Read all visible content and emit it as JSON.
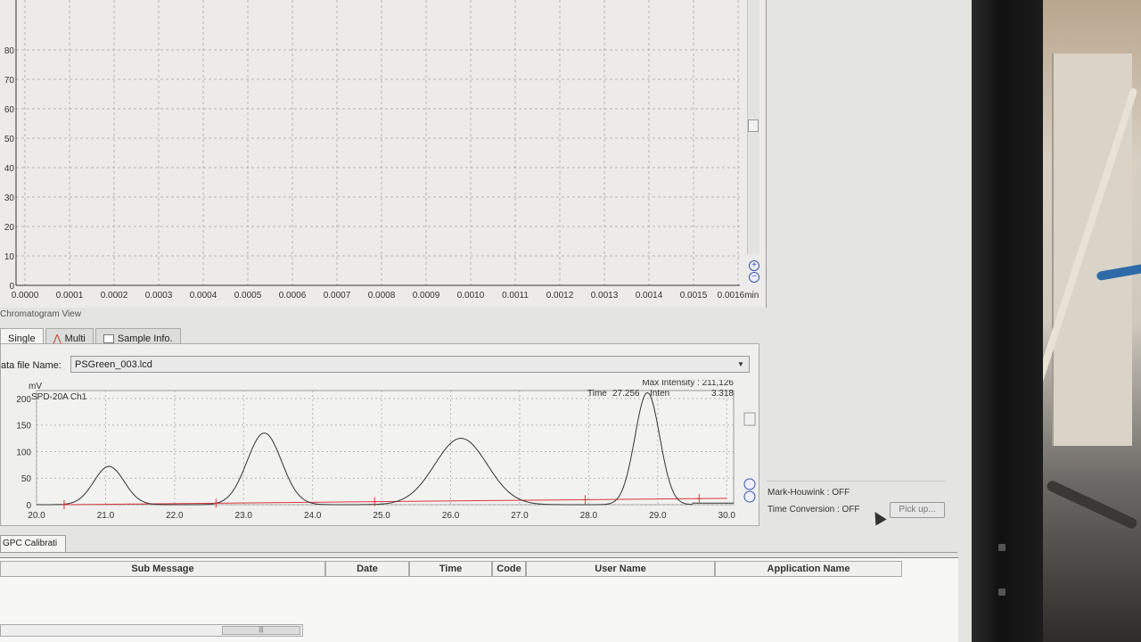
{
  "upper_plot": {
    "y_ticks": [
      "0",
      "10",
      "20",
      "30",
      "40",
      "50",
      "60",
      "70",
      "80"
    ],
    "x_ticks": [
      "0.0000",
      "0.0001",
      "0.0002",
      "0.0003",
      "0.0004",
      "0.0005",
      "0.0006",
      "0.0007",
      "0.0008",
      "0.0009",
      "0.0010",
      "0.0011",
      "0.0012",
      "0.0013",
      "0.0014",
      "0.0015",
      "0.0016"
    ],
    "x_unit": "min"
  },
  "chromatogram": {
    "section_title": "Chromatogram View",
    "tabs": [
      {
        "label": "Single",
        "active": true
      },
      {
        "label": "Multi",
        "active": false
      },
      {
        "label": "Sample Info.",
        "active": false
      }
    ],
    "file_label": "ata file Name:",
    "file_value": "PSGreen_003.lcd",
    "y_unit": "mV",
    "channel": "SPD-20A Ch1",
    "max_intensity": "Max Intensity : 211,126",
    "time_label": "Time",
    "time_value": "27.256",
    "inten_label": "Inten",
    "inten_value": "3.318"
  },
  "chart_data": {
    "type": "line",
    "title": "",
    "xlabel": "",
    "ylabel": "mV",
    "x_ticks": [
      "20.0",
      "21.0",
      "22.0",
      "23.0",
      "24.0",
      "25.0",
      "26.0",
      "27.0",
      "28.0",
      "29.0",
      "30.0"
    ],
    "y_ticks": [
      "0",
      "50",
      "100",
      "150",
      "200"
    ],
    "xlim": [
      20.0,
      30.1
    ],
    "ylim": [
      0,
      215
    ],
    "series": [
      {
        "name": "SPD-20A Ch1",
        "color": "#333333",
        "peaks": [
          {
            "center": 21.05,
            "height": 72,
            "width": 0.22
          },
          {
            "center": 23.3,
            "height": 135,
            "width": 0.25
          },
          {
            "center": 26.15,
            "height": 125,
            "width": 0.38
          },
          {
            "center": 28.85,
            "height": 211,
            "width": 0.18
          }
        ]
      }
    ],
    "baseline_color": "#d9363e",
    "baseline": [
      [
        20.4,
        0
      ],
      [
        30.0,
        12
      ]
    ],
    "markers": [
      20.4,
      22.6,
      24.9,
      27.95,
      29.6
    ]
  },
  "side_panel": {
    "mark_houwink": "Mark-Houwink : OFF",
    "time_conversion": "Time Conversion : OFF",
    "pickup_label": "Pick up..."
  },
  "bottom": {
    "tab_label": "GPC Calibrati",
    "columns": [
      "Sub Message",
      "Date",
      "Time",
      "Code",
      "User Name",
      "Application Name"
    ]
  },
  "colors": {
    "grid": "#b5b5b5",
    "trace": "#333333",
    "baseline": "#d9363e",
    "accent_blue": "#3a55a8"
  }
}
